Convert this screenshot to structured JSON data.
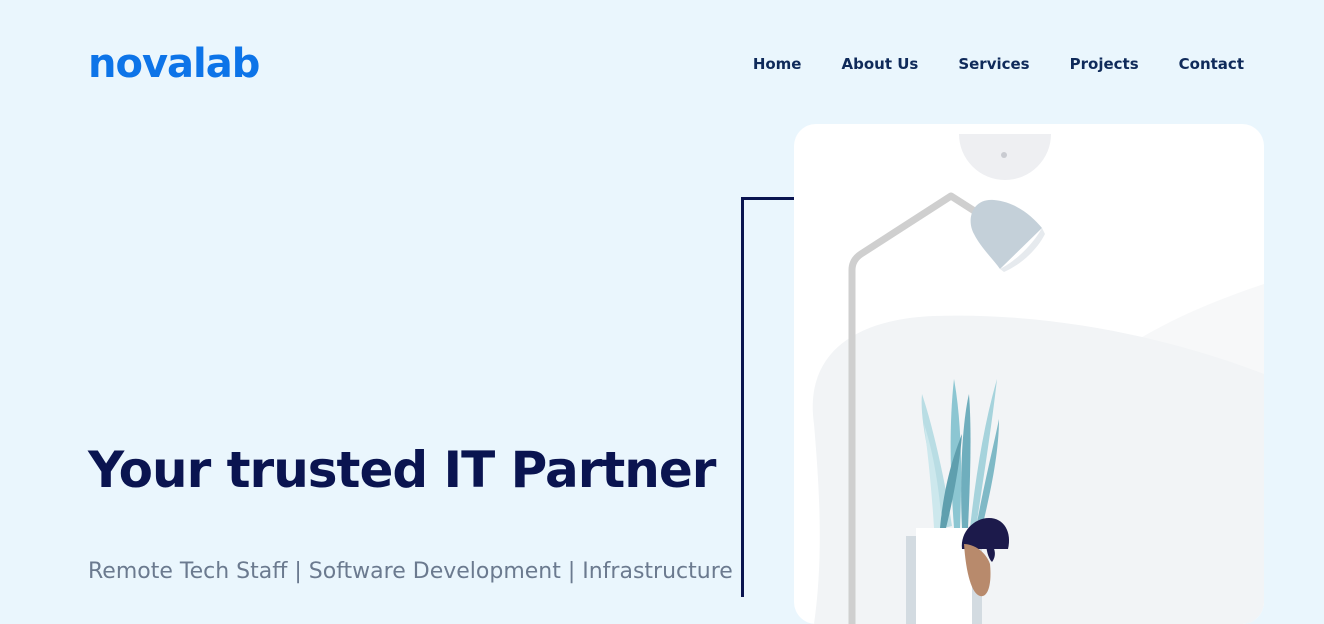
{
  "brand": {
    "name": "novalab"
  },
  "nav": {
    "items": [
      {
        "id": "home",
        "label": "Home"
      },
      {
        "id": "about",
        "label": "About Us"
      },
      {
        "id": "services",
        "label": "Services"
      },
      {
        "id": "projects",
        "label": "Projects"
      },
      {
        "id": "contact",
        "label": "Contact"
      }
    ]
  },
  "hero": {
    "title": "Your trusted IT Partner",
    "subtitle": "Remote Tech Staff | Software Development | Infrastructure"
  },
  "colors": {
    "background": "#eaf6fd",
    "brand": "#0d74e8",
    "heading": "#0a1450",
    "nav_text": "#0f2a5a"
  },
  "illustration": {
    "icons": [
      "floor-lamp-icon",
      "plant-icon",
      "person-icon"
    ]
  }
}
